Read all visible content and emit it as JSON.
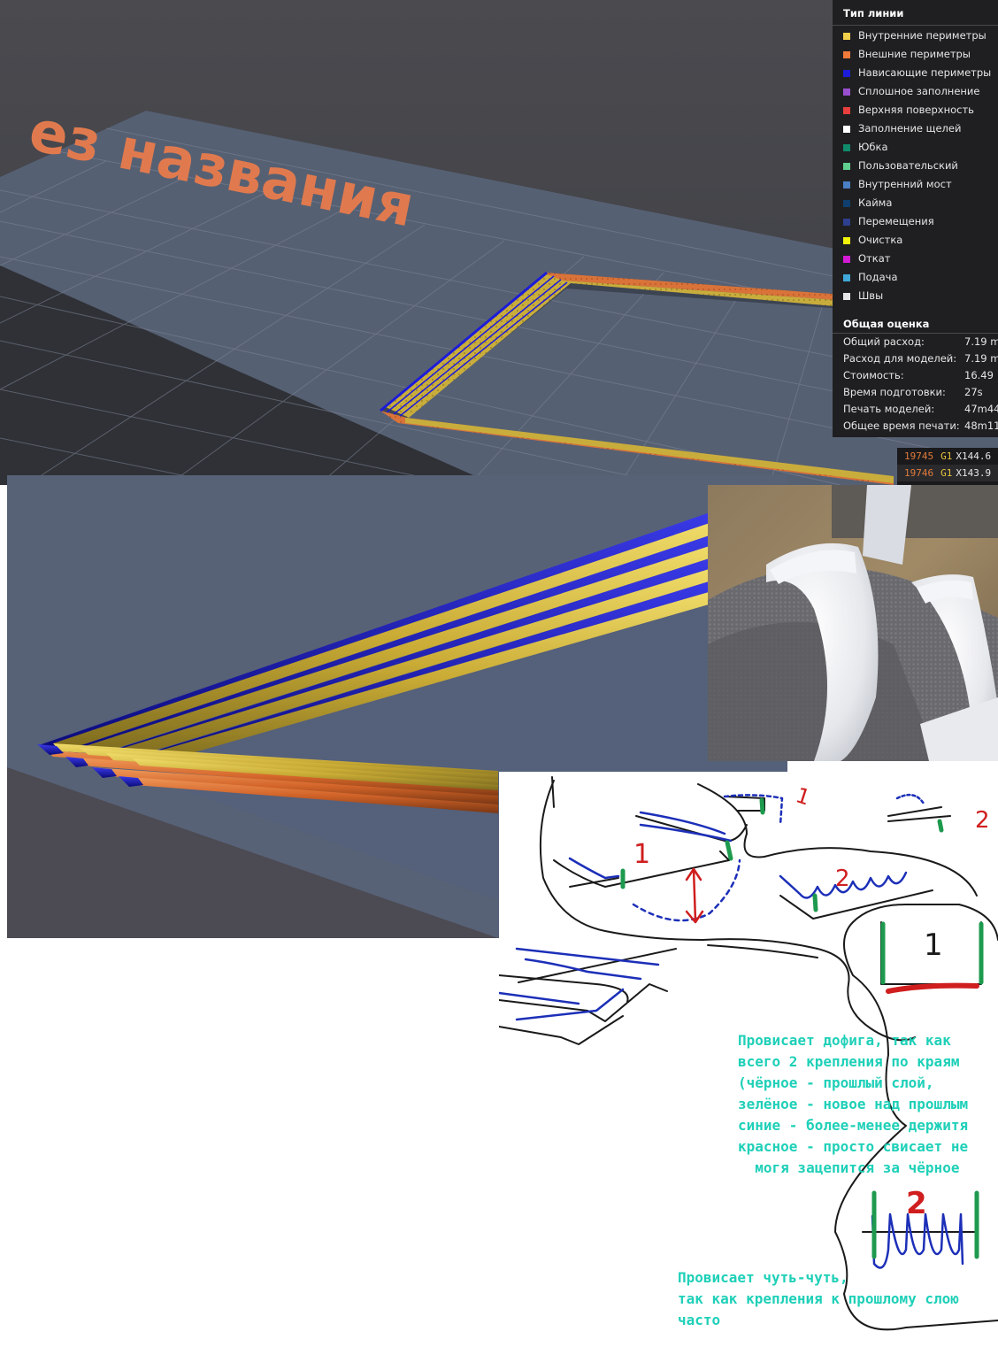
{
  "viewport": {
    "plate_label": "ез названия"
  },
  "legend": {
    "title": "Тип линии",
    "items": [
      {
        "label": "Внутренние периметры",
        "color": "#f2cf4a"
      },
      {
        "label": "Внешние периметры",
        "color": "#f07a3a"
      },
      {
        "label": "Нависающие периметры",
        "color": "#1c1cd9"
      },
      {
        "label": "Сплошное заполнение",
        "color": "#9a4fcf"
      },
      {
        "label": "Верхняя поверхность",
        "color": "#e83e3e"
      },
      {
        "label": "Заполнение щелей",
        "color": "#ffffff"
      },
      {
        "label": "Юбка",
        "color": "#0f8a6a"
      },
      {
        "label": "Пользовательский",
        "color": "#5fcf8f"
      },
      {
        "label": "Внутренний мост",
        "color": "#4a7fc4"
      },
      {
        "label": "Кайма",
        "color": "#0e3f6e"
      },
      {
        "label": "Перемещения",
        "color": "#2e3f8f"
      },
      {
        "label": "Очистка",
        "color": "#f2f20a"
      },
      {
        "label": "Откат",
        "color": "#d41ad4"
      },
      {
        "label": "Подача",
        "color": "#3fa8d8"
      },
      {
        "label": "Швы",
        "color": "#e6e6e6"
      }
    ],
    "summary_title": "Общая оценка",
    "summary": [
      {
        "key": "Общий расход:",
        "value": "7.19 m"
      },
      {
        "key": "Расход для моделей:",
        "value": "7.19 m"
      },
      {
        "key": "Стоимость:",
        "value": "16.49"
      },
      {
        "key": "Время подготовки:",
        "value": "27s"
      },
      {
        "key": "Печать моделей:",
        "value": "47m44"
      },
      {
        "key": "Общее время печати:",
        "value": "48m11"
      }
    ]
  },
  "gcode": [
    {
      "num": "19745",
      "cmd": "G1",
      "args": "X144.6"
    },
    {
      "num": "19746",
      "cmd": "G1",
      "args": "X143.9"
    }
  ],
  "sketch": {
    "labels": {
      "a": "1",
      "b": "1",
      "c": "2",
      "d": "2",
      "e": "1",
      "f": "2"
    },
    "note1": "Провисает дофига, так как\nвсего 2 крепления по краям\n(чёрное - прошлый слой,\nзелёное - новое над прошлым\nсиние - более-менее держитя\nкрасное - просто свисает не\n  могя зацепится за чёрное",
    "note2": "Провисает чуть-чуть,\nтак как крепления к прошлому слою\nчасто"
  }
}
